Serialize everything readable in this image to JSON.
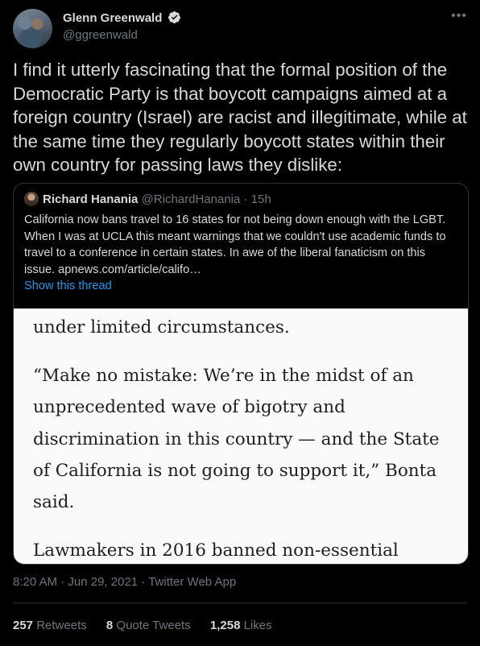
{
  "author": {
    "display_name": "Glenn Greenwald",
    "handle": "@ggreenwald",
    "verified": true,
    "avatar_icon": "group-photo-avatar"
  },
  "tweet": {
    "text": "I find it utterly fascinating that the formal position of the Democratic Party is that boycott campaigns aimed at a foreign country (Israel) are racist and illegitimate, while at the same time they regularly boycott states within their own country for passing laws they dislike:"
  },
  "quoted_tweet": {
    "display_name": "Richard Hanania",
    "handle": "@RichardHanania",
    "separator": "·",
    "time": "15h",
    "text": "California now bans travel to 16 states for not being down enough with the LGBT. When I was at UCLA this meant warnings that we couldn't use academic funds to travel to a conference in certain states. In awe of the liberal fanaticism on this issue. apnews.com/article/califo…",
    "show_thread": "Show this thread",
    "media": {
      "paragraphs": [
        "under limited circumstances.",
        "“Make no mistake: We’re in the midst of an unprecedented wave of bigotry and discrimination in this country — and the State of California is not going to support it,” Bonta said.",
        "Lawmakers in 2016 banned non-essential travel"
      ]
    }
  },
  "meta": {
    "time": "8:20 AM",
    "date": "Jun 29, 2021",
    "source": "Twitter Web App",
    "separator": "·"
  },
  "stats": {
    "retweets_count": "257",
    "retweets_label": "Retweets",
    "quotes_count": "8",
    "quotes_label": "Quote Tweets",
    "likes_count": "1,258",
    "likes_label": "Likes"
  },
  "colors": {
    "background": "#000000",
    "text": "#d9d9d9",
    "secondary": "#6e767d",
    "link": "#1d9bf0",
    "verified": "#d9d9d9",
    "border": "#2f3336"
  }
}
